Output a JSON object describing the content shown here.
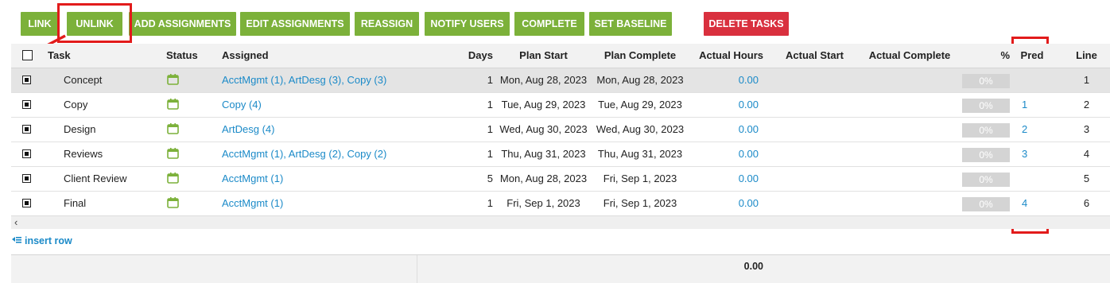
{
  "toolbar": {
    "link": "LINK",
    "unlink": "UNLINK",
    "add_assignments": "ADD ASSIGNMENTS",
    "edit_assignments": "EDIT ASSIGNMENTS",
    "reassign": "REASSIGN",
    "notify_users": "NOTIFY USERS",
    "complete": "COMPLETE",
    "set_baseline": "SET BASELINE",
    "delete_tasks": "DELETE TASKS"
  },
  "columns": {
    "task": "Task",
    "status": "Status",
    "assigned": "Assigned",
    "days": "Days",
    "plan_start": "Plan Start",
    "plan_complete": "Plan Complete",
    "actual_hours": "Actual Hours",
    "actual_start": "Actual Start",
    "actual_complete": "Actual Complete",
    "percent": "%",
    "pred": "Pred",
    "line": "Line"
  },
  "rows": [
    {
      "task": "Concept",
      "status_icon": "calendar-icon",
      "assigned": "AcctMgmt (1), ArtDesg (3), Copy (3)",
      "days": "1",
      "plan_start": "Mon, Aug 28, 2023",
      "plan_complete": "Mon, Aug 28, 2023",
      "actual_hours": "0.00",
      "actual_start": "",
      "actual_complete": "",
      "percent": "0%",
      "pred": "",
      "line": "1"
    },
    {
      "task": "Copy",
      "status_icon": "calendar-icon",
      "assigned": "Copy (4)",
      "days": "1",
      "plan_start": "Tue, Aug 29, 2023",
      "plan_complete": "Tue, Aug 29, 2023",
      "actual_hours": "0.00",
      "actual_start": "",
      "actual_complete": "",
      "percent": "0%",
      "pred": "1",
      "line": "2"
    },
    {
      "task": "Design",
      "status_icon": "calendar-icon",
      "assigned": "ArtDesg (4)",
      "days": "1",
      "plan_start": "Wed, Aug 30, 2023",
      "plan_complete": "Wed, Aug 30, 2023",
      "actual_hours": "0.00",
      "actual_start": "",
      "actual_complete": "",
      "percent": "0%",
      "pred": "2",
      "line": "3"
    },
    {
      "task": "Reviews",
      "status_icon": "calendar-icon",
      "assigned": "AcctMgmt (1), ArtDesg (2), Copy (2)",
      "days": "1",
      "plan_start": "Thu, Aug 31, 2023",
      "plan_complete": "Thu, Aug 31, 2023",
      "actual_hours": "0.00",
      "actual_start": "",
      "actual_complete": "",
      "percent": "0%",
      "pred": "3",
      "line": "4"
    },
    {
      "task": "Client Review",
      "status_icon": "calendar-icon",
      "assigned": "AcctMgmt (1)",
      "days": "5",
      "plan_start": "Mon, Aug 28, 2023",
      "plan_complete": "Fri, Sep 1, 2023",
      "actual_hours": "0.00",
      "actual_start": "",
      "actual_complete": "",
      "percent": "0%",
      "pred": "",
      "line": "5"
    },
    {
      "task": "Final",
      "status_icon": "calendar-icon",
      "assigned": "AcctMgmt (1)",
      "days": "1",
      "plan_start": "Fri, Sep 1, 2023",
      "plan_complete": "Fri, Sep 1, 2023",
      "actual_hours": "0.00",
      "actual_start": "",
      "actual_complete": "",
      "percent": "0%",
      "pred": "4",
      "line": "6"
    }
  ],
  "insert_row": "insert row",
  "footer": {
    "total_actual_hours": "0.00"
  },
  "colors": {
    "toolbar_green": "#7cb13a",
    "delete_red": "#d9303e",
    "link_blue": "#1b8ac8",
    "highlight_red": "#e21b1b",
    "status_icon_green": "#7cb13a"
  }
}
